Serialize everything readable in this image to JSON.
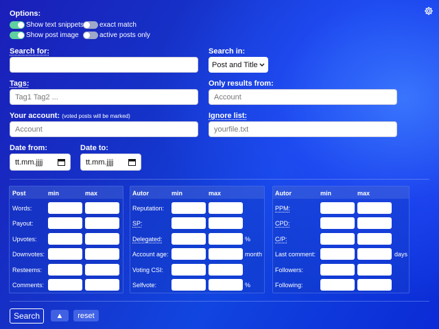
{
  "options": {
    "title": "Options:",
    "toggles": [
      {
        "label": "Show text snippets",
        "on": true
      },
      {
        "label": "exact match",
        "on": false
      },
      {
        "label": "Show post image",
        "on": true
      },
      {
        "label": "active posts only",
        "on": false
      }
    ]
  },
  "settings_icon": "gear-icon",
  "search": {
    "label": "Search for:",
    "value": ""
  },
  "search_in": {
    "label": "Search in:",
    "selected": "Post and Title"
  },
  "tags": {
    "label": "Tags:",
    "placeholder": "Tag1 Tag2 ..."
  },
  "only_results": {
    "label": "Only results from:",
    "placeholder": "Account"
  },
  "account": {
    "label": "Your account:",
    "note": "(voted posts will be marked)",
    "placeholder": "Account"
  },
  "ignore": {
    "label": "Ignore list:",
    "placeholder": "yourfile.txt"
  },
  "date_from": {
    "label": "Date from:",
    "value": "tt.mm.jjjj"
  },
  "date_to": {
    "label": "Date to:",
    "value": "tt.mm.jjjj"
  },
  "panels": {
    "post": {
      "title": "Post",
      "min": "min",
      "max": "max",
      "rows": [
        {
          "label": "Words:",
          "unit": ""
        },
        {
          "label": "Payout:",
          "unit": ""
        },
        {
          "label": "Upvotes:",
          "unit": ""
        },
        {
          "label": "Downvotes:",
          "unit": ""
        },
        {
          "label": "Resteems:",
          "unit": ""
        },
        {
          "label": "Comments:",
          "unit": ""
        }
      ]
    },
    "autor1": {
      "title": "Autor",
      "min": "min",
      "max": "max",
      "rows": [
        {
          "label": "Reputation:",
          "unit": ""
        },
        {
          "label": "SP:",
          "unit": ""
        },
        {
          "label": "Delegated:",
          "unit": "%"
        },
        {
          "label": "Account age:",
          "unit": "month"
        },
        {
          "label": "Voting CSI:",
          "unit": ""
        },
        {
          "label": "Selfvote:",
          "unit": "%"
        }
      ]
    },
    "autor2": {
      "title": "Autor",
      "min": "min",
      "max": "max",
      "rows": [
        {
          "label": "PPM:",
          "unit": ""
        },
        {
          "label": "CPD:",
          "unit": ""
        },
        {
          "label": "C/P:",
          "unit": ""
        },
        {
          "label": "Last comment:",
          "unit": "days"
        },
        {
          "label": "Followers:",
          "unit": ""
        },
        {
          "label": "Following:",
          "unit": ""
        }
      ]
    }
  },
  "buttons": {
    "search": "Search",
    "up": "▲",
    "reset": "reset"
  }
}
